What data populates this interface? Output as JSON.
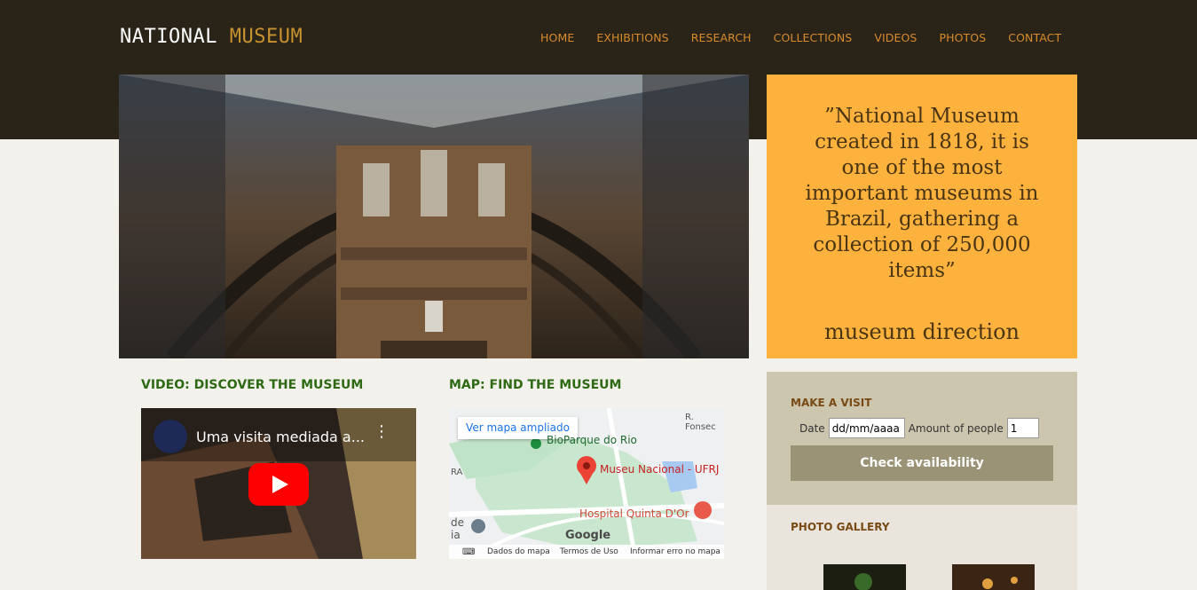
{
  "header": {
    "logo_part1": "NATIONAL",
    "logo_part2": "MUSEUM",
    "nav": [
      "HOME",
      "EXHIBITIONS",
      "RESEARCH",
      "COLLECTIONS",
      "VIDEOS",
      "PHOTOS",
      "CONTACT"
    ]
  },
  "quote": {
    "text": "”National Museum created in 1818, it is one of the most important museums in Brazil, gathering a collection of 250,000 items”",
    "author": "museum direction"
  },
  "video_section": {
    "title": "VIDEO: DISCOVER THE MUSEUM",
    "video_title": "Uma visita mediada a..."
  },
  "map_section": {
    "title": "MAP: FIND THE MUSEUM",
    "open_map": "Ver mapa ampliado",
    "labels": {
      "biopark": "BioParque do Rio",
      "museum": "Museu Nacional - UFRJ",
      "hospital": "Hospital Quinta D'Or",
      "street": "R. Fonsec",
      "left_top": "RA",
      "left_bottom": "de\nia"
    },
    "footer": [
      "Dados do mapa",
      "Termos de Uso",
      "Informar erro no mapa"
    ],
    "google": "Google"
  },
  "visit": {
    "title": "MAKE A VISIT",
    "date_label": "Date",
    "date_placeholder": "dd/mm/aaaa",
    "people_label": "Amount of people",
    "people_value": "1",
    "button": "Check availability"
  },
  "gallery": {
    "title": "PHOTO GALLERY"
  },
  "colors": {
    "header_bg": "#2a2418",
    "nav": "#d98a2b",
    "quote_bg": "#fdb23e",
    "section_title": "#2e6a14"
  }
}
